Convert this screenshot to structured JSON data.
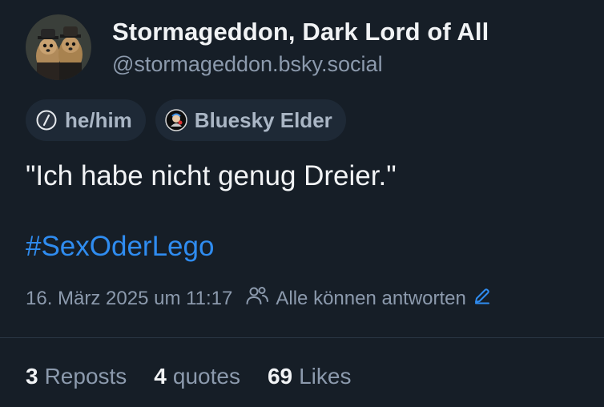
{
  "author": {
    "display_name": "Stormageddon, Dark Lord of All",
    "handle": "@stormageddon.bsky.social"
  },
  "labels": [
    {
      "icon": "pronoun-badge-icon",
      "text": "he/him"
    },
    {
      "icon": "bluesky-elder-badge-icon",
      "text": "Bluesky Elder"
    }
  ],
  "post": {
    "text": "\"Ich habe nicht genug Dreier.\"",
    "hashtag": "#SexOderLego",
    "timestamp": "16. März 2025 um 11:17",
    "reply_setting": "Alle können antworten"
  },
  "stats": {
    "reposts_count": "3",
    "reposts_label": "Reposts",
    "quotes_count": "4",
    "quotes_label": "quotes",
    "likes_count": "69",
    "likes_label": "Likes"
  },
  "colors": {
    "background": "#161e27",
    "link": "#2f8cf0",
    "muted": "#8c9aad"
  }
}
